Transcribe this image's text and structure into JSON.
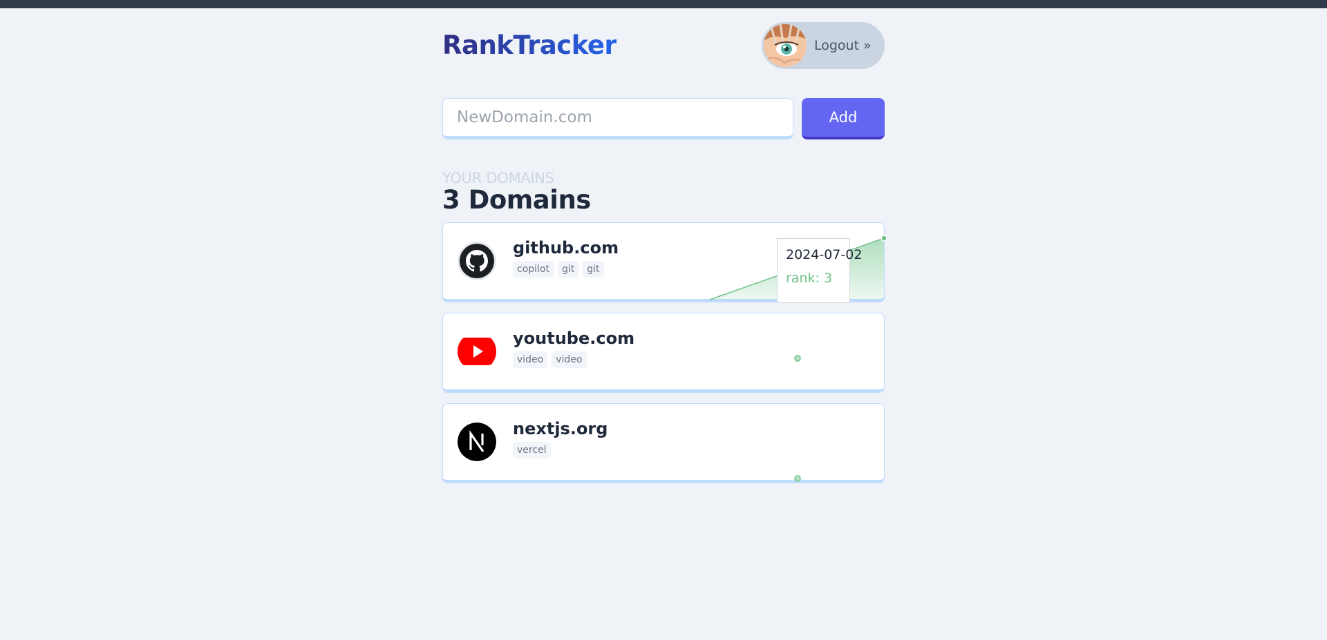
{
  "app": {
    "title": "RankTracker"
  },
  "header": {
    "logout_label": "Logout »"
  },
  "add_domain": {
    "placeholder": "NewDomain.com",
    "button_label": "Add"
  },
  "section": {
    "kicker": "YOUR DOMAINS",
    "title": "3 Domains"
  },
  "domains": [
    {
      "name": "github.com",
      "icon": "github-icon",
      "tags": [
        "copilot",
        "git",
        "git"
      ]
    },
    {
      "name": "youtube.com",
      "icon": "youtube-icon",
      "tags": [
        "video",
        "video"
      ]
    },
    {
      "name": "nextjs.org",
      "icon": "nextjs-icon",
      "tags": [
        "vercel"
      ]
    }
  ],
  "tooltip": {
    "date": "2024-07-02",
    "value_label": "rank: 3"
  },
  "colors": {
    "accent": "#6366f1",
    "brand_from": "#312e81",
    "brand_to": "#2563eb",
    "chart_green": "#6fc38a"
  }
}
